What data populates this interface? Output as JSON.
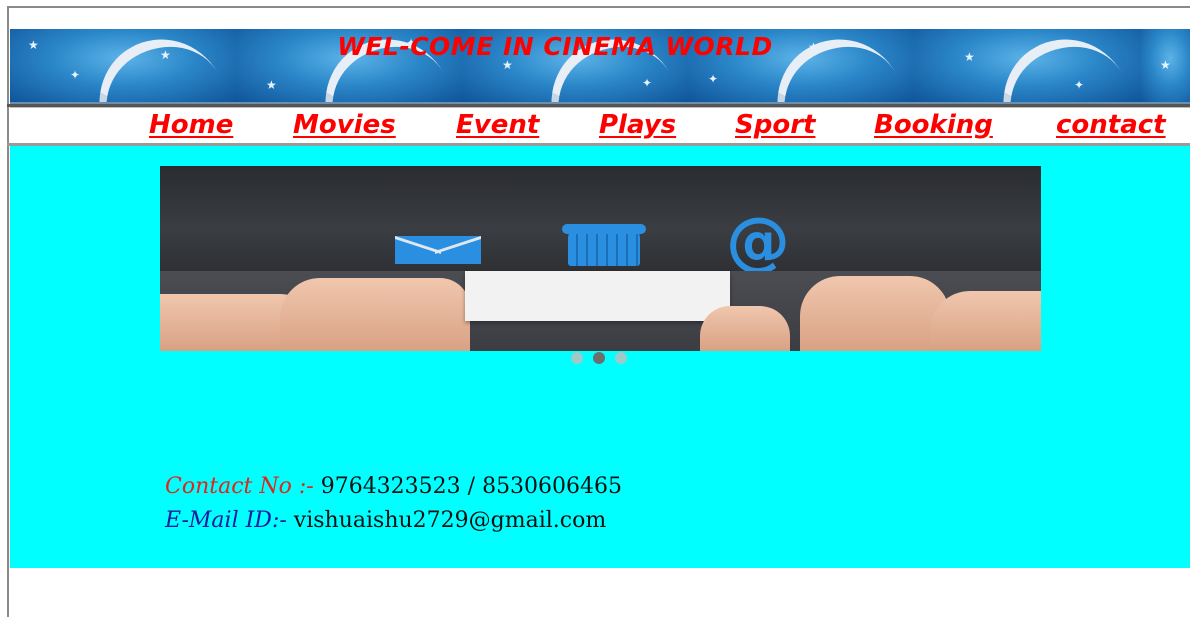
{
  "header": {
    "title": "WEL-COME IN CINEMA WORLD"
  },
  "nav": {
    "items": [
      {
        "label": "Home"
      },
      {
        "label": "Movies"
      },
      {
        "label": "Event"
      },
      {
        "label": "Plays"
      },
      {
        "label": "Sport"
      },
      {
        "label": "Booking"
      },
      {
        "label": "contact"
      }
    ]
  },
  "slider": {
    "icons": [
      "mail-icon",
      "telephone-icon",
      "at-sign-icon"
    ],
    "active_index": 1,
    "slide_count": 3
  },
  "contact": {
    "phone_label": "Contact No :-",
    "phone_value": " 9764323523 / 8530606465",
    "email_label": "E-Mail ID:-",
    "email_value": " vishuaishu2729@gmail.com"
  },
  "colors": {
    "title": "#ff0000",
    "nav_link": "#ff0000",
    "main_background": "#00ffff",
    "phone_label": "#e0261a",
    "email_label": "#1a1a9e"
  }
}
